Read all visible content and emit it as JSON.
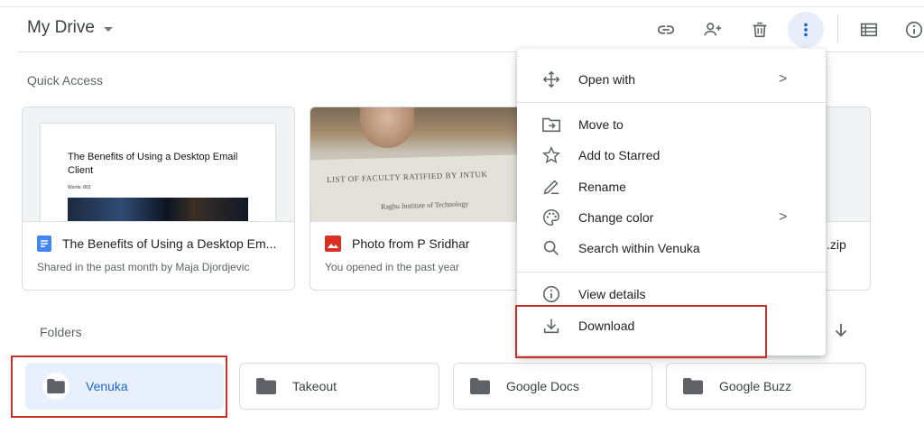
{
  "header": {
    "title": "My Drive",
    "icons": [
      "link-icon",
      "add-person-icon",
      "trash-icon",
      "more-vert-icon",
      "list-view-icon",
      "info-icon"
    ]
  },
  "quick_access": {
    "label": "Quick Access",
    "cards": [
      {
        "name": "The Benefits of Using a Desktop Em...",
        "subtitle": "Shared in the past month by Maja Djordjevic",
        "thumb_title": "The Benefits of Using a Desktop Email Client",
        "thumb_subtitle": "Words: 803",
        "icon": "google-docs-icon"
      },
      {
        "name": "Photo from P Sridhar",
        "subtitle": "You opened in the past year",
        "thumb_line1": "LIST OF FACULTY RATIFIED BY JNTUK",
        "thumb_line2": "Raghu Institute of Technology",
        "icon": "image-icon"
      },
      {
        "name": ".zip"
      }
    ]
  },
  "folders": {
    "label": "Folders",
    "items": [
      {
        "name": "Venuka",
        "selected": true
      },
      {
        "name": "Takeout"
      },
      {
        "name": "Google Docs"
      },
      {
        "name": "Google Buzz"
      }
    ]
  },
  "context_menu": {
    "items": [
      {
        "label": "Open with",
        "icon": "open-with-icon",
        "submenu": true
      },
      {
        "label": "Move to",
        "icon": "move-to-icon"
      },
      {
        "label": "Add to Starred",
        "icon": "star-icon"
      },
      {
        "label": "Rename",
        "icon": "pencil-icon"
      },
      {
        "label": "Change color",
        "icon": "palette-icon",
        "submenu": true
      },
      {
        "label": "Search within Venuka",
        "icon": "search-icon"
      },
      {
        "label": "View details",
        "icon": "info-icon"
      },
      {
        "label": "Download",
        "icon": "download-icon"
      }
    ],
    "chevron": ">"
  },
  "colors": {
    "accent": "#1967d2",
    "selected_bg": "#e8f0fe",
    "highlight_box": "#c9302c",
    "docs_blue": "#4285f4",
    "image_red": "#d93025"
  }
}
